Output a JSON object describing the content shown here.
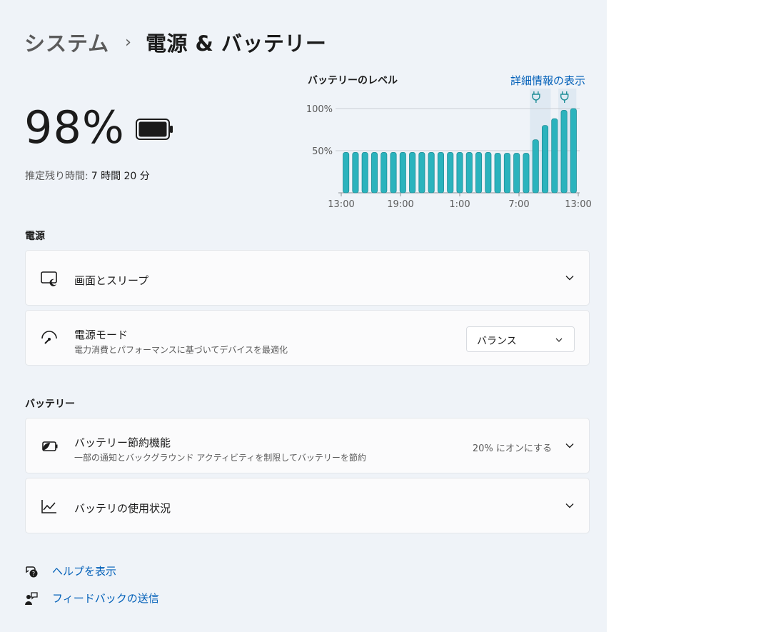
{
  "header": {
    "parent": "システム",
    "separator": "›",
    "current": "電源 & バッテリー"
  },
  "battery": {
    "percent_text": "98%",
    "percent": 98,
    "estimate_label": "推定残り時間:",
    "estimate_value": "7 時間 20 分"
  },
  "chart": {
    "title": "バッテリーのレベル",
    "details_link": "詳細情報の表示",
    "accent_color": "#2bb3bd",
    "chart_data": {
      "type": "bar",
      "ytick_labels": [
        "100%",
        "50%"
      ],
      "xtick_labels": [
        "13:00",
        "19:00",
        "1:00",
        "7:00",
        "13:00"
      ],
      "ylim": [
        0,
        100
      ],
      "values": [
        48,
        48,
        48,
        48,
        48,
        48,
        48,
        48,
        48,
        48,
        48,
        48,
        48,
        48,
        48,
        48,
        47,
        47,
        47,
        47,
        63,
        80,
        88,
        98,
        100
      ],
      "charging_markers": [
        "plug-icon",
        "plug-icon"
      ]
    }
  },
  "power": {
    "section_label": "電源",
    "screen_sleep": {
      "title": "画面とスリープ",
      "icon": "screen-sleep-icon"
    },
    "power_mode": {
      "title": "電源モード",
      "subtitle": "電力消費とパフォーマンスに基づいてデバイスを最適化",
      "selected": "バランス",
      "icon": "gauge-icon"
    }
  },
  "battery_section": {
    "section_label": "バッテリー",
    "saver": {
      "title": "バッテリー節約機能",
      "subtitle": "一部の通知とバックグラウンド アクティビティを制限してバッテリーを節約",
      "status": "20% にオンにする",
      "icon": "battery-saver-icon"
    },
    "usage": {
      "title": "バッテリの使用状況",
      "icon": "chart-line-icon"
    }
  },
  "links": {
    "help": "ヘルプを表示",
    "feedback": "フィードバックの送信"
  }
}
